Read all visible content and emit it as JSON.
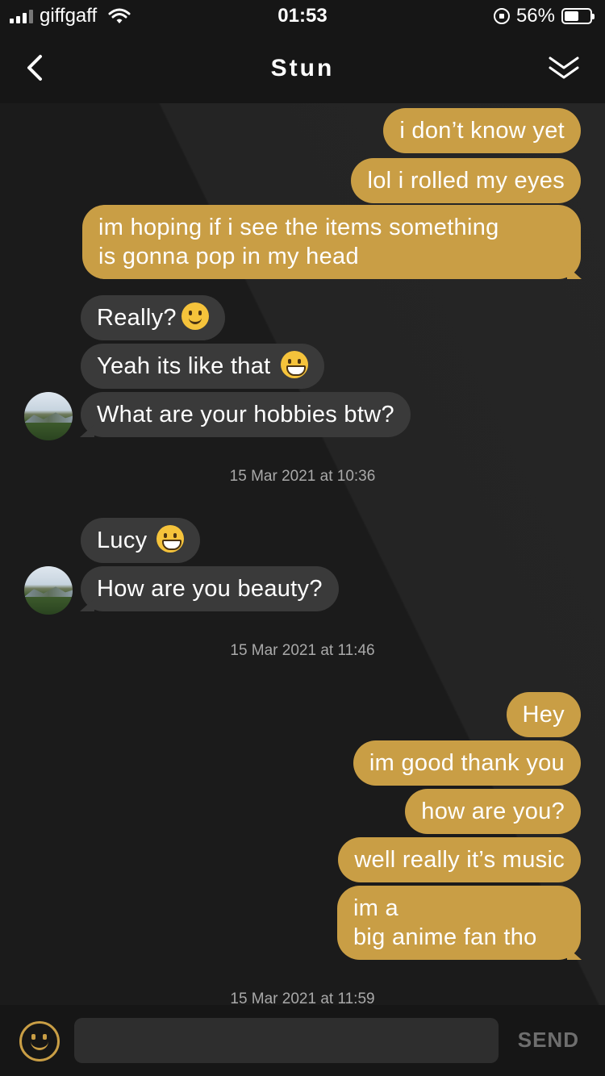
{
  "status_bar": {
    "carrier": "giffgaff",
    "time": "01:53",
    "battery": "56%",
    "battery_level": 0.56
  },
  "header": {
    "title": "Stun",
    "back_icon": "chevron-left-icon",
    "collapse_icon": "double-chevron-down-icon"
  },
  "messages": [
    {
      "dir": "out",
      "text": "i don’t know yet"
    },
    {
      "dir": "out",
      "text": "lol i rolled my eyes"
    },
    {
      "dir": "out",
      "text_lines": [
        "im hoping if i see the items something",
        "is gonna pop in my head"
      ]
    },
    {
      "dir": "in",
      "text": "Really?",
      "emoji": "slightly-smiling-face-icon"
    },
    {
      "dir": "in",
      "text": "Yeah its like that",
      "emoji": "grinning-face-icon"
    },
    {
      "dir": "in",
      "text": "What are your hobbies btw?"
    },
    {
      "dir": "in",
      "text": "Lucy",
      "emoji": "grinning-face-icon"
    },
    {
      "dir": "in",
      "text": "How are you beauty?"
    },
    {
      "dir": "out",
      "text": "Hey"
    },
    {
      "dir": "out",
      "text": "im good thank you"
    },
    {
      "dir": "out",
      "text": "how are you?"
    },
    {
      "dir": "out",
      "text": "well really it’s music"
    },
    {
      "dir": "out",
      "text_lines": [
        "im a",
        "big anime fan tho"
      ]
    }
  ],
  "timestamps": [
    "15 Mar 2021 at 10:36",
    "15 Mar 2021 at 11:46",
    "15 Mar 2021 at 11:59"
  ],
  "input_bar": {
    "placeholder": "",
    "send_label": "SEND",
    "emoji_icon": "smiley-face-icon"
  },
  "colors": {
    "outgoing_bubble": "#c99e45",
    "incoming_bubble": "#3a3a3a",
    "background": "#1d1d1d",
    "bar": "#161616"
  }
}
